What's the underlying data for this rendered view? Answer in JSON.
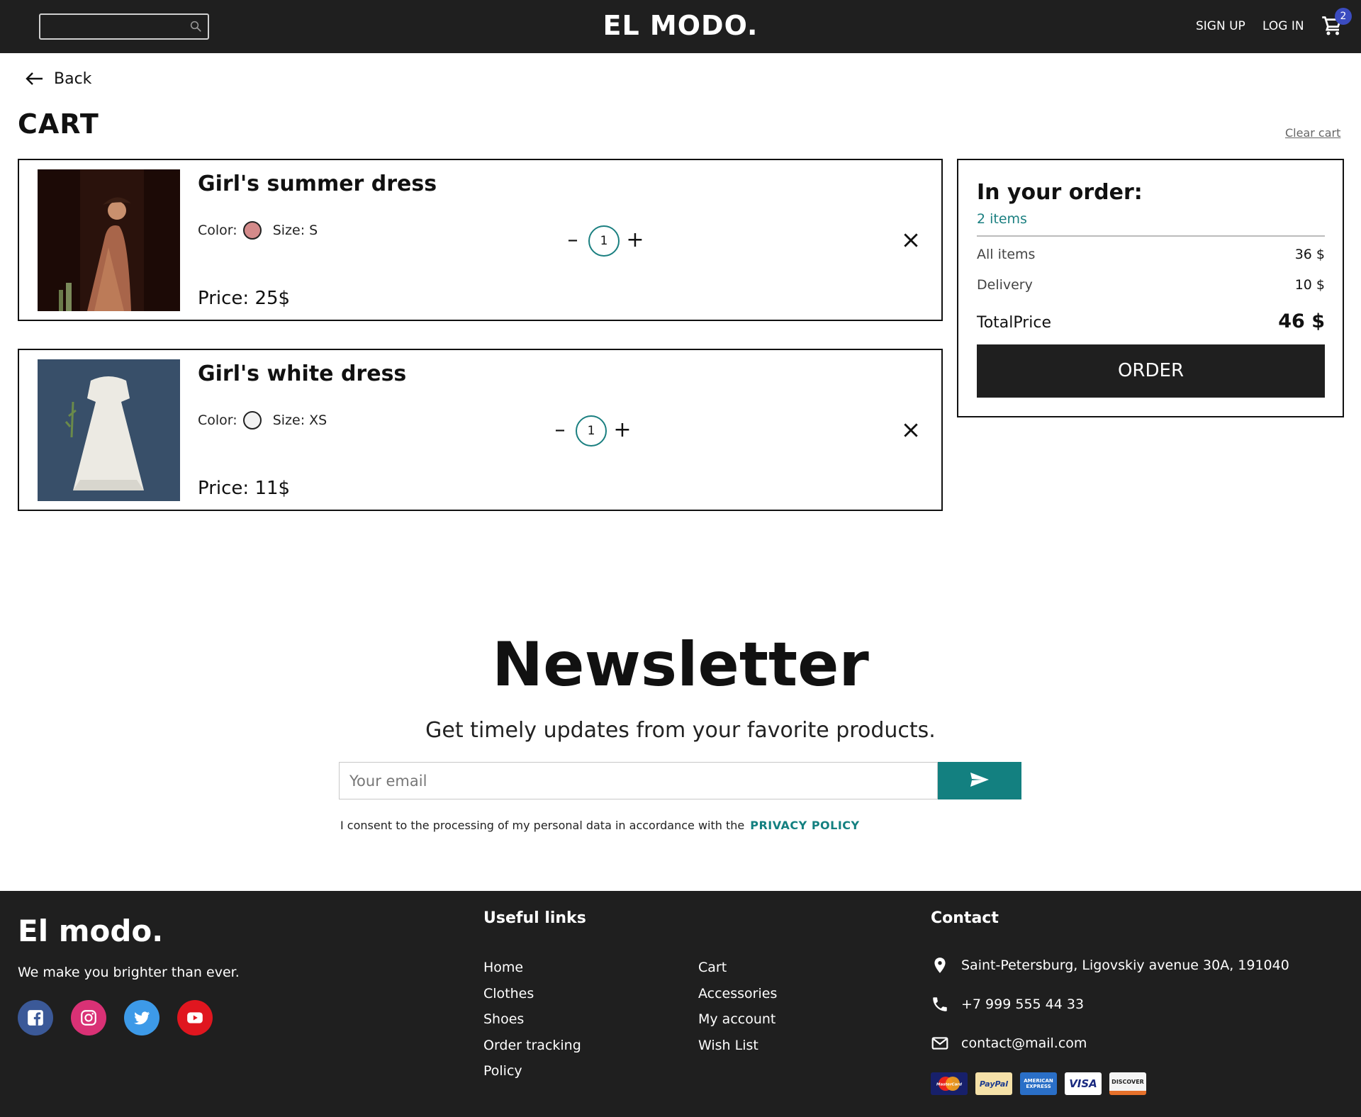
{
  "header": {
    "search_placeholder": "",
    "logo": "EL MODO.",
    "signup": "SIGN UP",
    "login": "LOG IN",
    "cart_count": "2"
  },
  "cart": {
    "back_label": "Back",
    "title": "CART",
    "clear_label": "Clear cart",
    "color_label": "Color:",
    "items": [
      {
        "name": "Girl's summer dress",
        "size": "Size: S",
        "price": "Price: 25$",
        "quantity": "1",
        "color_hex": "#d48a8a"
      },
      {
        "name": "Girl's white dress",
        "size": "Size: XS",
        "price": "Price: 11$",
        "quantity": "1",
        "color_hex": "#f2f2f2"
      }
    ]
  },
  "summary": {
    "title": "In your order:",
    "count": "2 items",
    "all_items_label": "All items",
    "all_items_value": "36 $",
    "delivery_label": "Delivery",
    "delivery_value": "10 $",
    "total_label": "TotalPrice",
    "total_value": "46 $",
    "order_button": "ORDER"
  },
  "newsletter": {
    "title": "Newsletter",
    "subtitle": "Get timely updates from your favorite products.",
    "email_placeholder": "Your email",
    "consent_text": "I consent to the processing of my personal data in accordance with the",
    "policy_link": "PRIVACY POLICY"
  },
  "footer": {
    "logo": "El modo.",
    "tagline": "We make you brighter than ever.",
    "useful_heading": "Useful links",
    "links_col1": [
      "Home",
      "Clothes",
      "Shoes",
      "Order tracking",
      "Policy"
    ],
    "links_col2": [
      "Cart",
      "Accessories",
      "My account",
      "Wish List"
    ],
    "contact_heading": "Contact",
    "address": "Saint-Petersburg, Ligovskiy avenue 30A, 191040",
    "phone": "+7 999 555 44 33",
    "email": "contact@mail.com",
    "payments": {
      "mastercard": "MasterCard",
      "paypal": "PayPal",
      "amex": "AMERICAN EXPRESS",
      "visa": "VISA",
      "discover": "DISCOVER"
    }
  },
  "colors": {
    "accent_teal": "#138080",
    "dark_bg": "#1f1f1f",
    "badge_blue": "#3b4cc0"
  }
}
